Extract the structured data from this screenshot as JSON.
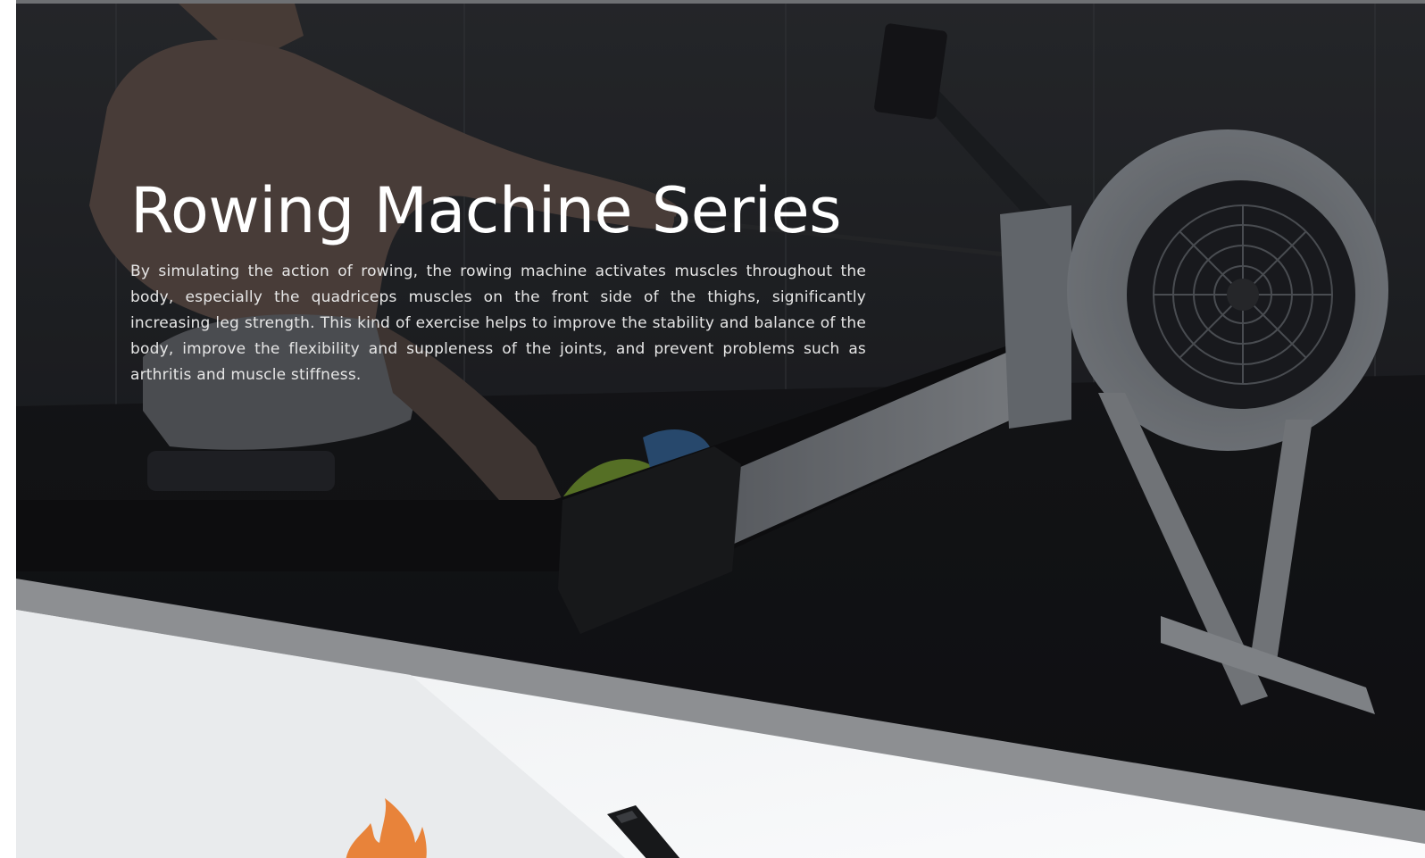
{
  "hero": {
    "title": "Rowing Machine Series",
    "description": "By simulating the action of rowing, the rowing machine activates muscles throughout the body, especially the quadriceps muscles on the front side of the thighs, significantly increasing leg strength. This kind of exercise helps to improve the stability and balance of the body, improve the flexibility and suppleness of the joints, and prevent problems such as arthritis and muscle stiffness."
  },
  "icons": {
    "flame": "flame-icon",
    "monitor": "rowing-monitor-icon"
  },
  "colors": {
    "hero_overlay": "#1c1e21",
    "diagonal_band": "#8d8f92",
    "lower_section": "#f4f5f6",
    "accent_orange": "#e8833a",
    "title_text": "#ffffff"
  }
}
